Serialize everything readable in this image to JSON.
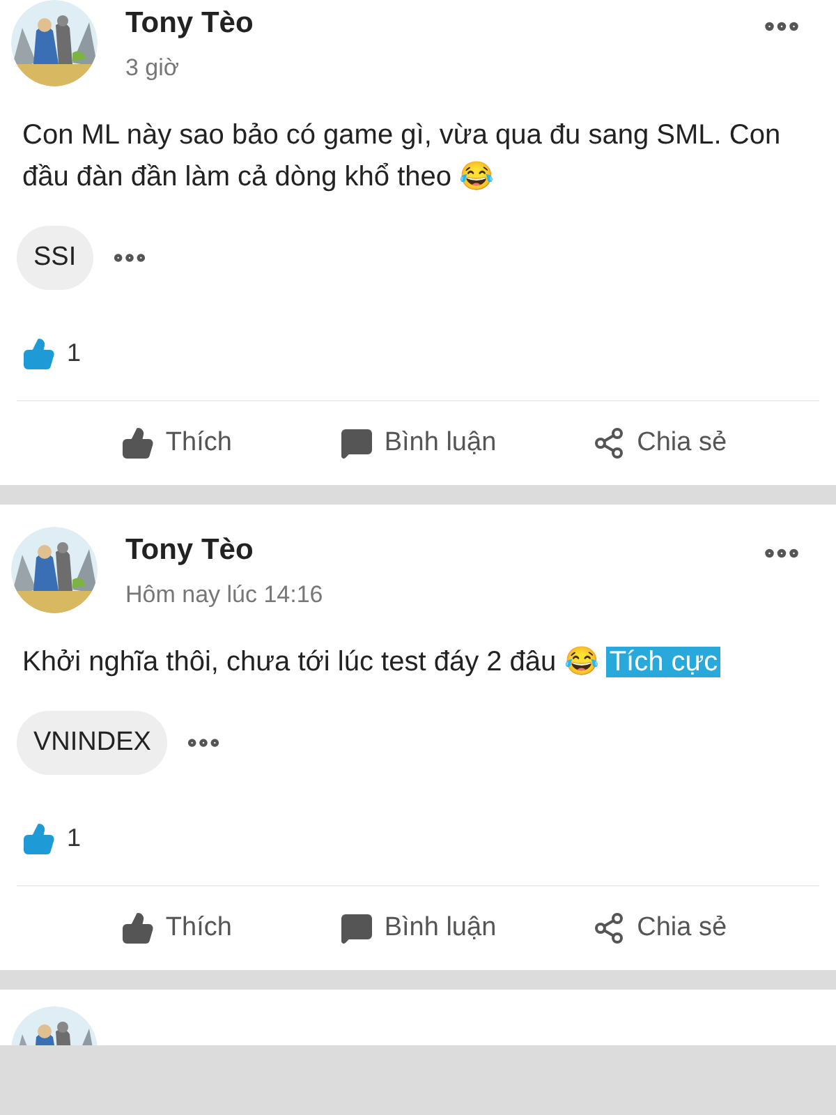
{
  "posts": [
    {
      "author": "Tony Tèo",
      "time": "3 giờ",
      "body": "Con ML này sao bảo có game gì, vừa qua đu sang SML. Con đầu đàn đần làm cả dòng khổ theo",
      "emoji": "😂",
      "tickers": [
        "SSI"
      ],
      "like_count": "1",
      "actions": [
        "Thích",
        "Bình luận",
        "Chia sẻ"
      ]
    },
    {
      "author": "Tony Tèo",
      "time": "Hôm nay lúc 14:16",
      "body": "Khởi nghĩa thôi, chưa tới lúc test đáy 2 đâu",
      "emoji": "😂",
      "highlight": "Tích cực",
      "tickers": [
        "VNINDEX"
      ],
      "like_count": "1",
      "actions": [
        "Thích",
        "Bình luận",
        "Chia sẻ"
      ]
    }
  ]
}
